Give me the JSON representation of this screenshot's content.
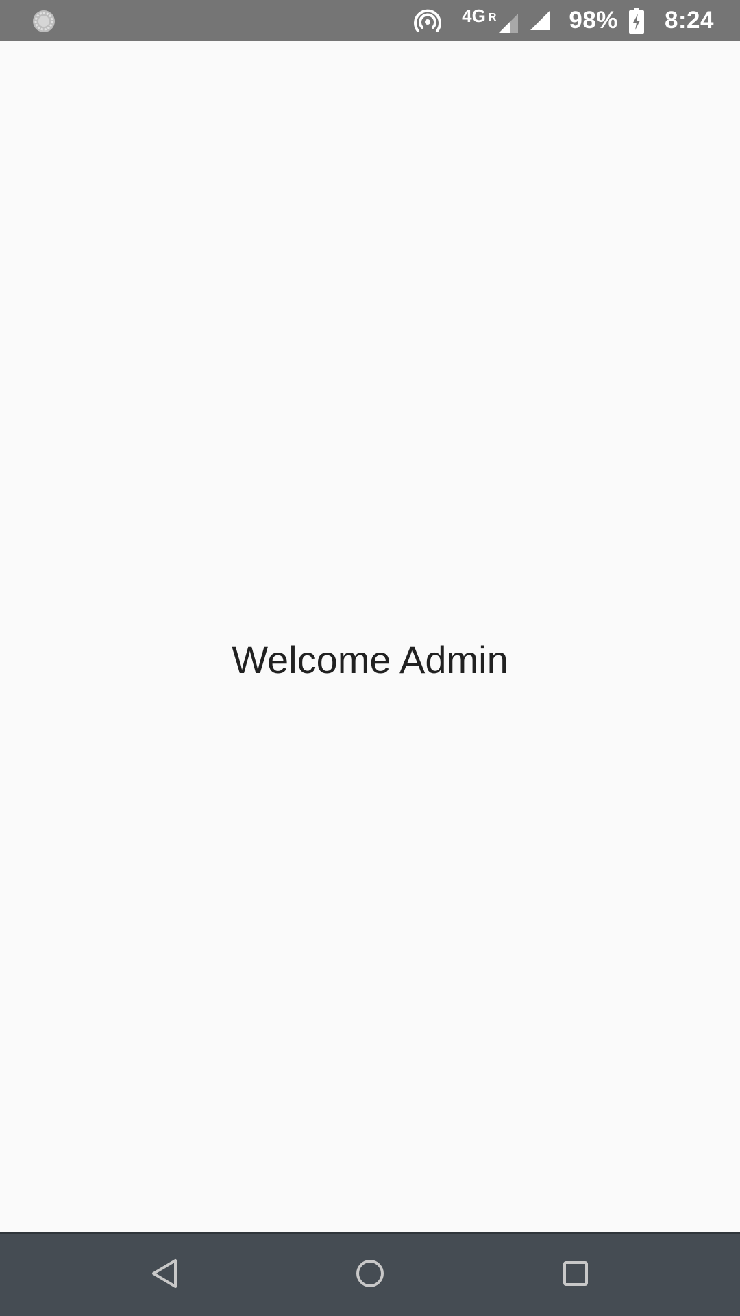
{
  "status_bar": {
    "network_type": "4G",
    "roaming_indicator": "R",
    "battery_percent": "98%",
    "time": "8:24",
    "icons": [
      "loading-icon",
      "hotspot-icon",
      "signal-roaming-icon",
      "signal-icon",
      "battery-charging-icon"
    ],
    "background_color": "#757575"
  },
  "main": {
    "welcome_text": "Welcome Admin",
    "background_color": "#fafafa",
    "text_color": "#212121"
  },
  "nav_bar": {
    "buttons": [
      "back-icon",
      "home-icon",
      "recents-icon"
    ],
    "background_color": "#454c53"
  }
}
